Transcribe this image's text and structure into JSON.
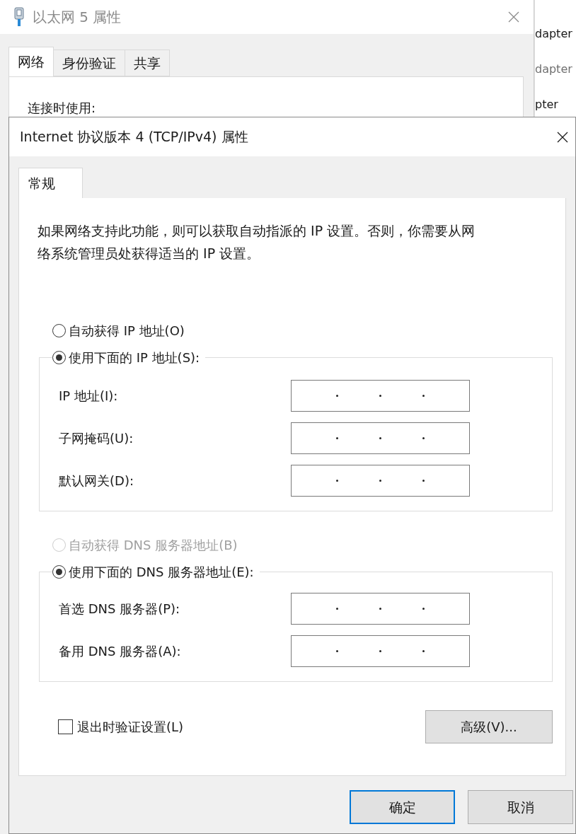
{
  "background_window": {
    "title": "以太网 5 属性",
    "tabs": [
      {
        "label": "网络",
        "selected": true
      },
      {
        "label": "身份验证",
        "selected": false
      },
      {
        "label": "共享",
        "selected": false
      }
    ],
    "section_label": "连接时使用:"
  },
  "behind_window_text": [
    {
      "text": "dapter",
      "dimmed": false
    },
    {
      "text": "dapter",
      "dimmed": true
    },
    {
      "text": "pter",
      "dimmed": false
    }
  ],
  "dialog": {
    "title": "Internet 协议版本 4 (TCP/IPv4) 属性",
    "tabs": [
      {
        "label": "常规",
        "selected": true
      }
    ],
    "description": "如果网络支持此功能，则可以获取自动指派的 IP 设置。否则，你需要从网络系统管理员处获得适当的 IP 设置。",
    "ip_options": [
      {
        "label": "自动获得 IP 地址(O)",
        "selected": false,
        "disabled": false
      },
      {
        "label": "使用下面的 IP 地址(S):",
        "selected": true,
        "disabled": false
      }
    ],
    "ip_fields": [
      {
        "label": "IP 地址(I):",
        "disabled": false
      },
      {
        "label": "子网掩码(U):",
        "disabled": false
      },
      {
        "label": "默认网关(D):",
        "disabled": false
      }
    ],
    "dns_options": [
      {
        "label": "自动获得 DNS 服务器地址(B)",
        "selected": false,
        "disabled": true
      },
      {
        "label": "使用下面的 DNS 服务器地址(E):",
        "selected": true,
        "disabled": false
      }
    ],
    "dns_fields": [
      {
        "label": "首选 DNS 服务器(P):",
        "disabled": false
      },
      {
        "label": "备用 DNS 服务器(A):",
        "disabled": false
      }
    ],
    "validate_checkbox": {
      "label": "退出时验证设置(L)",
      "checked": false
    },
    "advanced_button": "高级(V)...",
    "buttons": [
      {
        "label": "确定",
        "default": true
      },
      {
        "label": "取消",
        "default": false
      }
    ]
  }
}
